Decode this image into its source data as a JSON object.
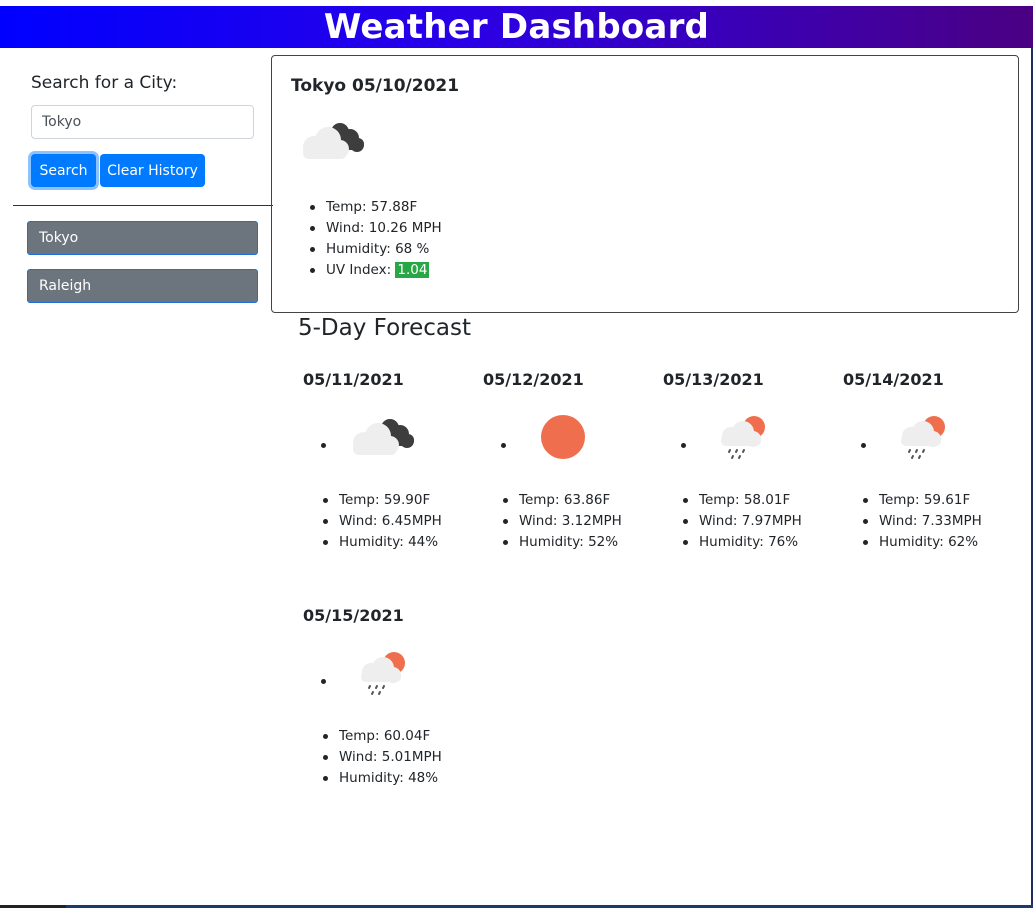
{
  "header": {
    "title": "Weather Dashboard"
  },
  "search": {
    "label": "Search for a City:",
    "value": "Tokyo",
    "search_button": "Search",
    "clear_button": "Clear History"
  },
  "history": [
    "Tokyo",
    "Raleigh"
  ],
  "current": {
    "title": "Tokyo 05/10/2021",
    "icon": "broken-clouds-icon",
    "temp": "Temp: 57.88F",
    "wind": "Wind: 10.26 MPH",
    "humidity": "Humidity: 68 %",
    "uv_label": "UV Index: ",
    "uv_value": "1.04",
    "uv_color": "#28a745"
  },
  "forecast": {
    "title": "5-Day Forecast",
    "days": [
      {
        "date": "05/11/2021",
        "icon": "broken-clouds-icon",
        "temp": "Temp: 59.90F",
        "wind": "Wind: 6.45MPH",
        "humidity": "Humidity: 44%"
      },
      {
        "date": "05/12/2021",
        "icon": "clear-sky-icon",
        "temp": "Temp: 63.86F",
        "wind": "Wind: 3.12MPH",
        "humidity": "Humidity: 52%"
      },
      {
        "date": "05/13/2021",
        "icon": "rain-sun-icon",
        "temp": "Temp: 58.01F",
        "wind": "Wind: 7.97MPH",
        "humidity": "Humidity: 76%"
      },
      {
        "date": "05/14/2021",
        "icon": "rain-sun-icon",
        "temp": "Temp: 59.61F",
        "wind": "Wind: 7.33MPH",
        "humidity": "Humidity: 62%"
      },
      {
        "date": "05/15/2021",
        "icon": "rain-sun-icon",
        "temp": "Temp: 60.04F",
        "wind": "Wind: 5.01MPH",
        "humidity": "Humidity: 48%"
      }
    ]
  },
  "colors": {
    "primary": "#007bff",
    "history_bg": "#6c757d",
    "sun": "#ee6e4d",
    "dark_cloud": "#3d3d3d",
    "light_cloud": "#eeeeee"
  }
}
